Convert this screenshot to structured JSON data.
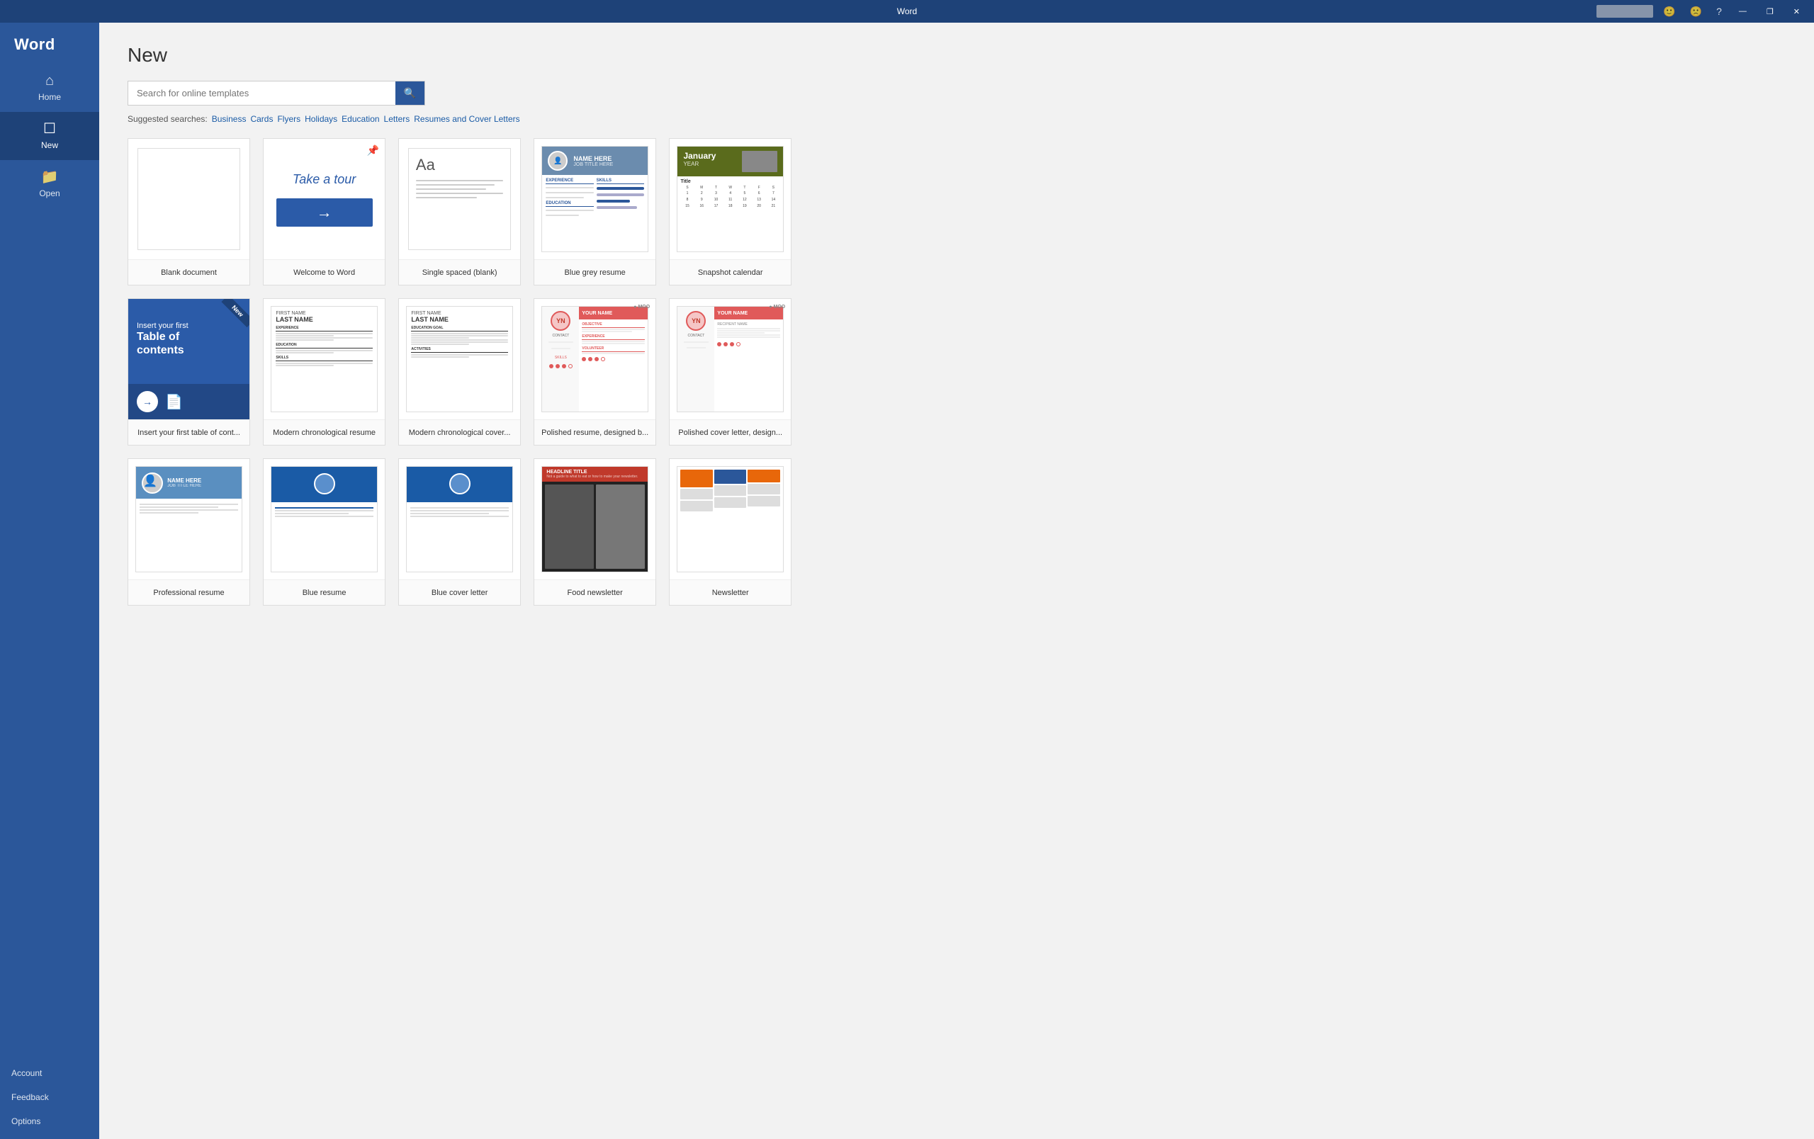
{
  "titlebar": {
    "title": "Word",
    "controls": {
      "minimize": "—",
      "maximize": "❐",
      "close": "✕"
    }
  },
  "sidebar": {
    "logo": "Word",
    "nav_items": [
      {
        "id": "home",
        "icon": "⌂",
        "label": "Home",
        "active": false
      },
      {
        "id": "new",
        "icon": "☐",
        "label": "New",
        "active": true
      },
      {
        "id": "open",
        "icon": "📁",
        "label": "Open",
        "active": false
      }
    ],
    "bottom_items": [
      {
        "id": "account",
        "label": "Account"
      },
      {
        "id": "feedback",
        "label": "Feedback"
      },
      {
        "id": "options",
        "label": "Options"
      }
    ]
  },
  "main": {
    "title": "New",
    "search": {
      "placeholder": "Search for online templates",
      "button_icon": "🔍"
    },
    "suggested_searches": {
      "label": "Suggested searches:",
      "items": [
        "Business",
        "Cards",
        "Flyers",
        "Holidays",
        "Education",
        "Letters",
        "Resumes and Cover Letters"
      ]
    },
    "templates": [
      {
        "id": "blank",
        "type": "blank",
        "label": "Blank document",
        "pinnable": false
      },
      {
        "id": "welcome",
        "type": "welcome",
        "label": "Welcome to Word",
        "pinnable": true,
        "welcome_text": "Take a tour",
        "has_pin": true
      },
      {
        "id": "single-spaced",
        "type": "single-spaced",
        "label": "Single spaced (blank)",
        "pinnable": false
      },
      {
        "id": "blue-grey-resume",
        "type": "blue-grey-resume",
        "label": "Blue grey resume",
        "pinnable": false
      },
      {
        "id": "snapshot-calendar",
        "type": "snapshot-calendar",
        "label": "Snapshot calendar",
        "month": "January",
        "year": "YEAR",
        "pinnable": false
      },
      {
        "id": "toc",
        "type": "toc",
        "label": "Insert your first table of cont...",
        "is_new": true,
        "insert_text": "Insert your first",
        "main_text": "Table of\ncontents"
      },
      {
        "id": "modern-chron-resume",
        "type": "modern-resume",
        "label": "Modern chronological resume",
        "pinnable": false
      },
      {
        "id": "modern-chron-cover",
        "type": "modern-cover",
        "label": "Modern chronological cover...",
        "pinnable": false
      },
      {
        "id": "polished-resume",
        "type": "polished-resume",
        "label": "Polished resume, designed b...",
        "initials": "YN",
        "pinnable": false
      },
      {
        "id": "polished-cover",
        "type": "polished-cover",
        "label": "Polished cover letter, design...",
        "initials": "YN",
        "pinnable": false
      },
      {
        "id": "professional-resume",
        "type": "professional-resume",
        "label": "Professional resume",
        "pinnable": false
      },
      {
        "id": "blue-resume",
        "type": "blue-resume",
        "label": "Blue resume",
        "pinnable": false
      },
      {
        "id": "blue-cover",
        "type": "blue-cover",
        "label": "Blue cover letter",
        "pinnable": false
      },
      {
        "id": "food-newsletter",
        "type": "food-newsletter",
        "label": "Food newsletter",
        "pinnable": false
      },
      {
        "id": "orange-multi",
        "type": "orange-multi",
        "label": "Newsletter",
        "pinnable": false
      }
    ]
  }
}
